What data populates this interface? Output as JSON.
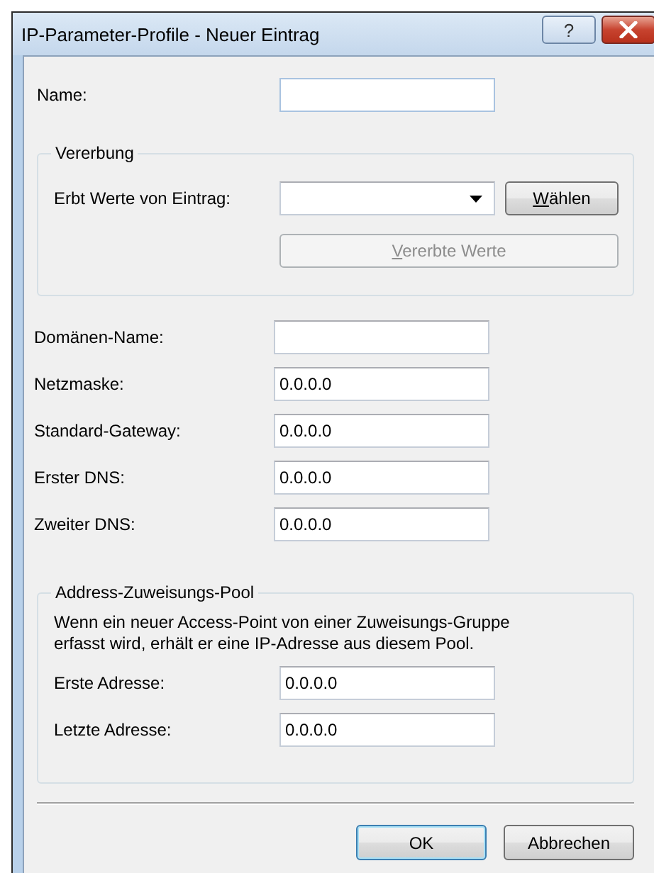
{
  "window": {
    "title": "IP-Parameter-Profile - Neuer Eintrag",
    "help_button": "?"
  },
  "name_field": {
    "label": "Name:"
  },
  "inheritance": {
    "legend": "Vererbung",
    "label": "Erbt Werte von Eintrag:",
    "choose_button": {
      "label": "Wählen",
      "disabled": false
    },
    "inherited_button": {
      "label": "Vererbte Werte",
      "disabled": true
    }
  },
  "fields": [
    {
      "label": "Domänen-Name:"
    },
    {
      "label": "Netzmaske:",
      "value": "0.0.0.0"
    },
    {
      "label": "Standard-Gateway:",
      "value": "0.0.0.0"
    },
    {
      "label": "Erster DNS:",
      "value": "0.0.0.0"
    },
    {
      "label": "Zweiter DNS:",
      "value": "0.0.0.0"
    }
  ],
  "pool": {
    "legend": "Address-Zuweisungs-Pool",
    "description": "Wenn ein neuer Access-Point von einer Zuweisungs-Gruppe erfasst wird, erhält er eine IP-Adresse aus diesem Pool.",
    "fields": [
      {
        "label": "Erste Adresse:",
        "value": "0.0.0.0"
      },
      {
        "label": "Letzte Adresse:",
        "value": "0.0.0.0"
      }
    ]
  },
  "buttons": [
    {
      "label": "OK",
      "default": true
    },
    {
      "label": "Abbrechen",
      "default": false
    }
  ]
}
